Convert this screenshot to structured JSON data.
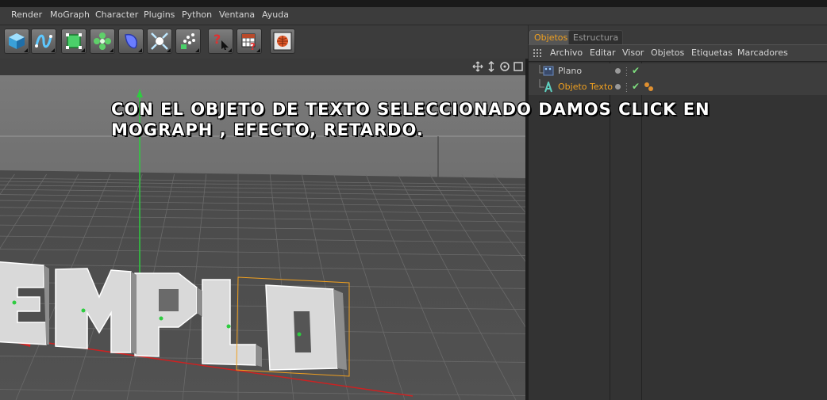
{
  "menubar": {
    "items": [
      "Render",
      "MoGraph",
      "Character",
      "Plugins",
      "Python",
      "Ventana",
      "Ayuda"
    ]
  },
  "toolbar": {
    "tools": [
      "cube-icon",
      "spline-icon",
      "nurbs-icon",
      "array-icon",
      "deformer-icon",
      "scene-icon",
      "particles-icon",
      "help-icon",
      "render-settings-icon",
      "render-globe-icon"
    ]
  },
  "viewport": {
    "header_icons": [
      "move-view-icon",
      "zoom-view-icon",
      "rotate-view-icon",
      "maximize-view-icon"
    ],
    "text_object": "EMPLO"
  },
  "object_manager": {
    "tabs": [
      {
        "label": "Objetos",
        "active": true
      },
      {
        "label": "Estructura",
        "active": false
      }
    ],
    "menu": [
      "Archivo",
      "Editar",
      "Visor",
      "Objetos",
      "Etiquetas",
      "Marcadores"
    ],
    "objects": [
      {
        "name": "Plano",
        "icon": "plane-object-icon",
        "selected": false
      },
      {
        "name": "Objeto Texto",
        "icon": "text-object-icon",
        "selected": true
      }
    ]
  },
  "overlay": {
    "line1": "Con el objeto de texto seleccionado damos click en",
    "line2": "mograph , efecto, retardo."
  },
  "colors": {
    "accent": "#f0a020",
    "check": "#7fe07f",
    "y_axis": "#2ecc40",
    "x_axis": "#cc2222"
  }
}
